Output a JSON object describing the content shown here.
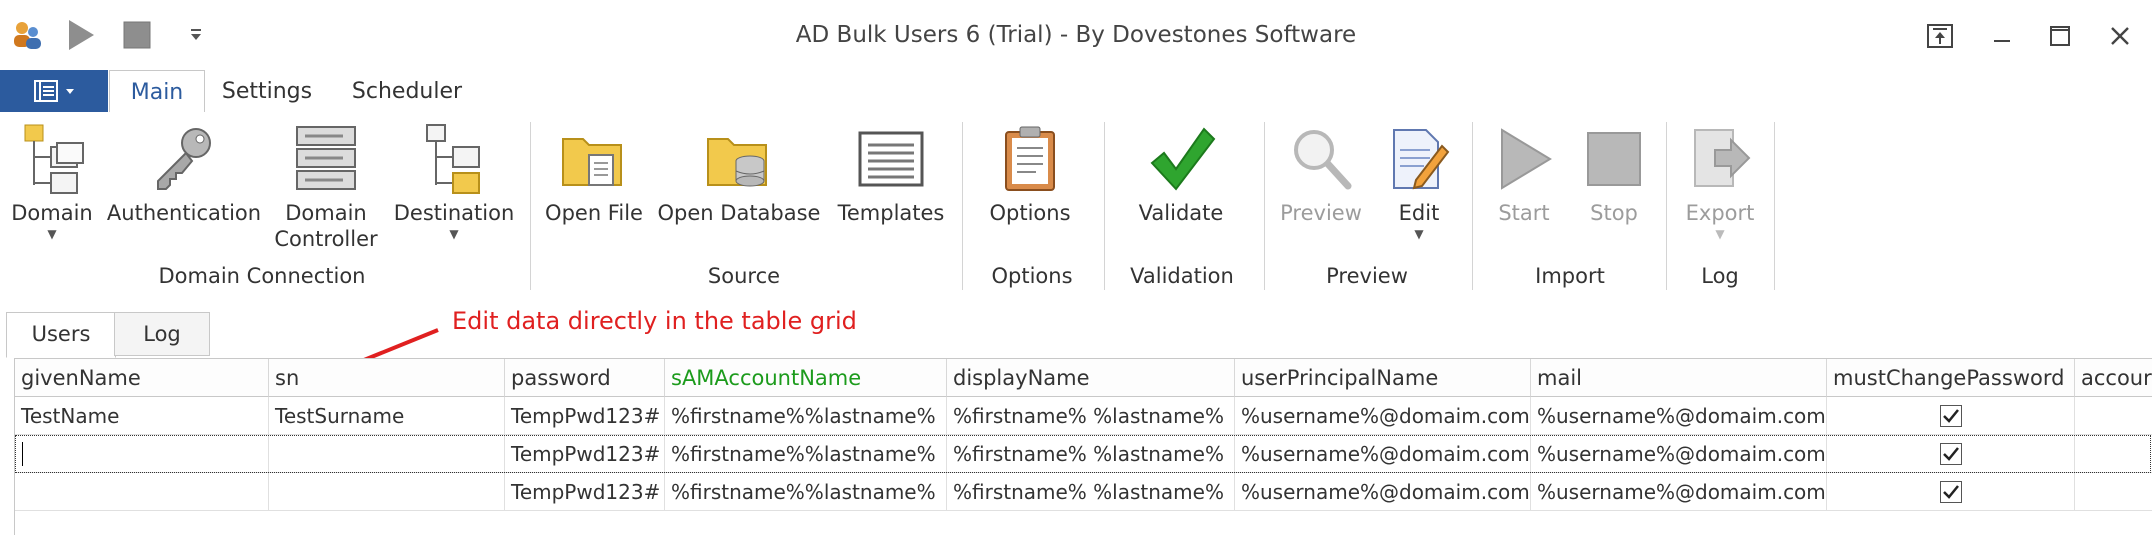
{
  "window": {
    "title": "AD Bulk Users 6 (Trial) - By Dovestones Software"
  },
  "icons": {
    "app": "users-app-icon",
    "run": "play-icon",
    "stop": "stop-square-icon",
    "qat_menu": "chevron-down-icon"
  },
  "ribbon_tabs": [
    "Main",
    "Settings",
    "Scheduler"
  ],
  "ribbon": {
    "domain": "Domain",
    "authentication": "Authentication",
    "domain_controller_1": "Domain",
    "domain_controller_2": "Controller",
    "destination": "Destination",
    "open_file": "Open File",
    "open_database": "Open Database",
    "templates": "Templates",
    "options": "Options",
    "validate": "Validate",
    "preview": "Preview",
    "edit": "Edit",
    "start": "Start",
    "stop": "Stop",
    "export": "Export"
  },
  "groups": {
    "domain_connection": "Domain Connection",
    "source": "Source",
    "options": "Options",
    "validation": "Validation",
    "preview": "Preview",
    "import": "Import",
    "log": "Log"
  },
  "doc_tabs": [
    "Users",
    "Log"
  ],
  "annotation": "Edit data directly in the table grid",
  "colors": {
    "file_button": "#2c5b9e",
    "annotation": "#e02020",
    "key_column": "#1c9b1c"
  },
  "grid": {
    "columns": [
      "givenName",
      "sn",
      "password",
      "sAMAccountName",
      "displayName",
      "userPrincipalName",
      "mail",
      "mustChangePassword",
      "accour"
    ],
    "rows": [
      [
        "TestName",
        "TestSurname",
        "TempPwd123#",
        "%firstname%%lastname%",
        "%firstname% %lastname%",
        "%username%@domaim.com",
        "%username%@domaim.com",
        true,
        ""
      ],
      [
        "",
        "",
        "TempPwd123#",
        "%firstname%%lastname%",
        "%firstname% %lastname%",
        "%username%@domaim.com",
        "%username%@domaim.com",
        true,
        ""
      ],
      [
        "",
        "",
        "TempPwd123#",
        "%firstname%%lastname%",
        "%firstname% %lastname%",
        "%username%@domaim.com",
        "%username%@domaim.com",
        true,
        ""
      ]
    ]
  }
}
